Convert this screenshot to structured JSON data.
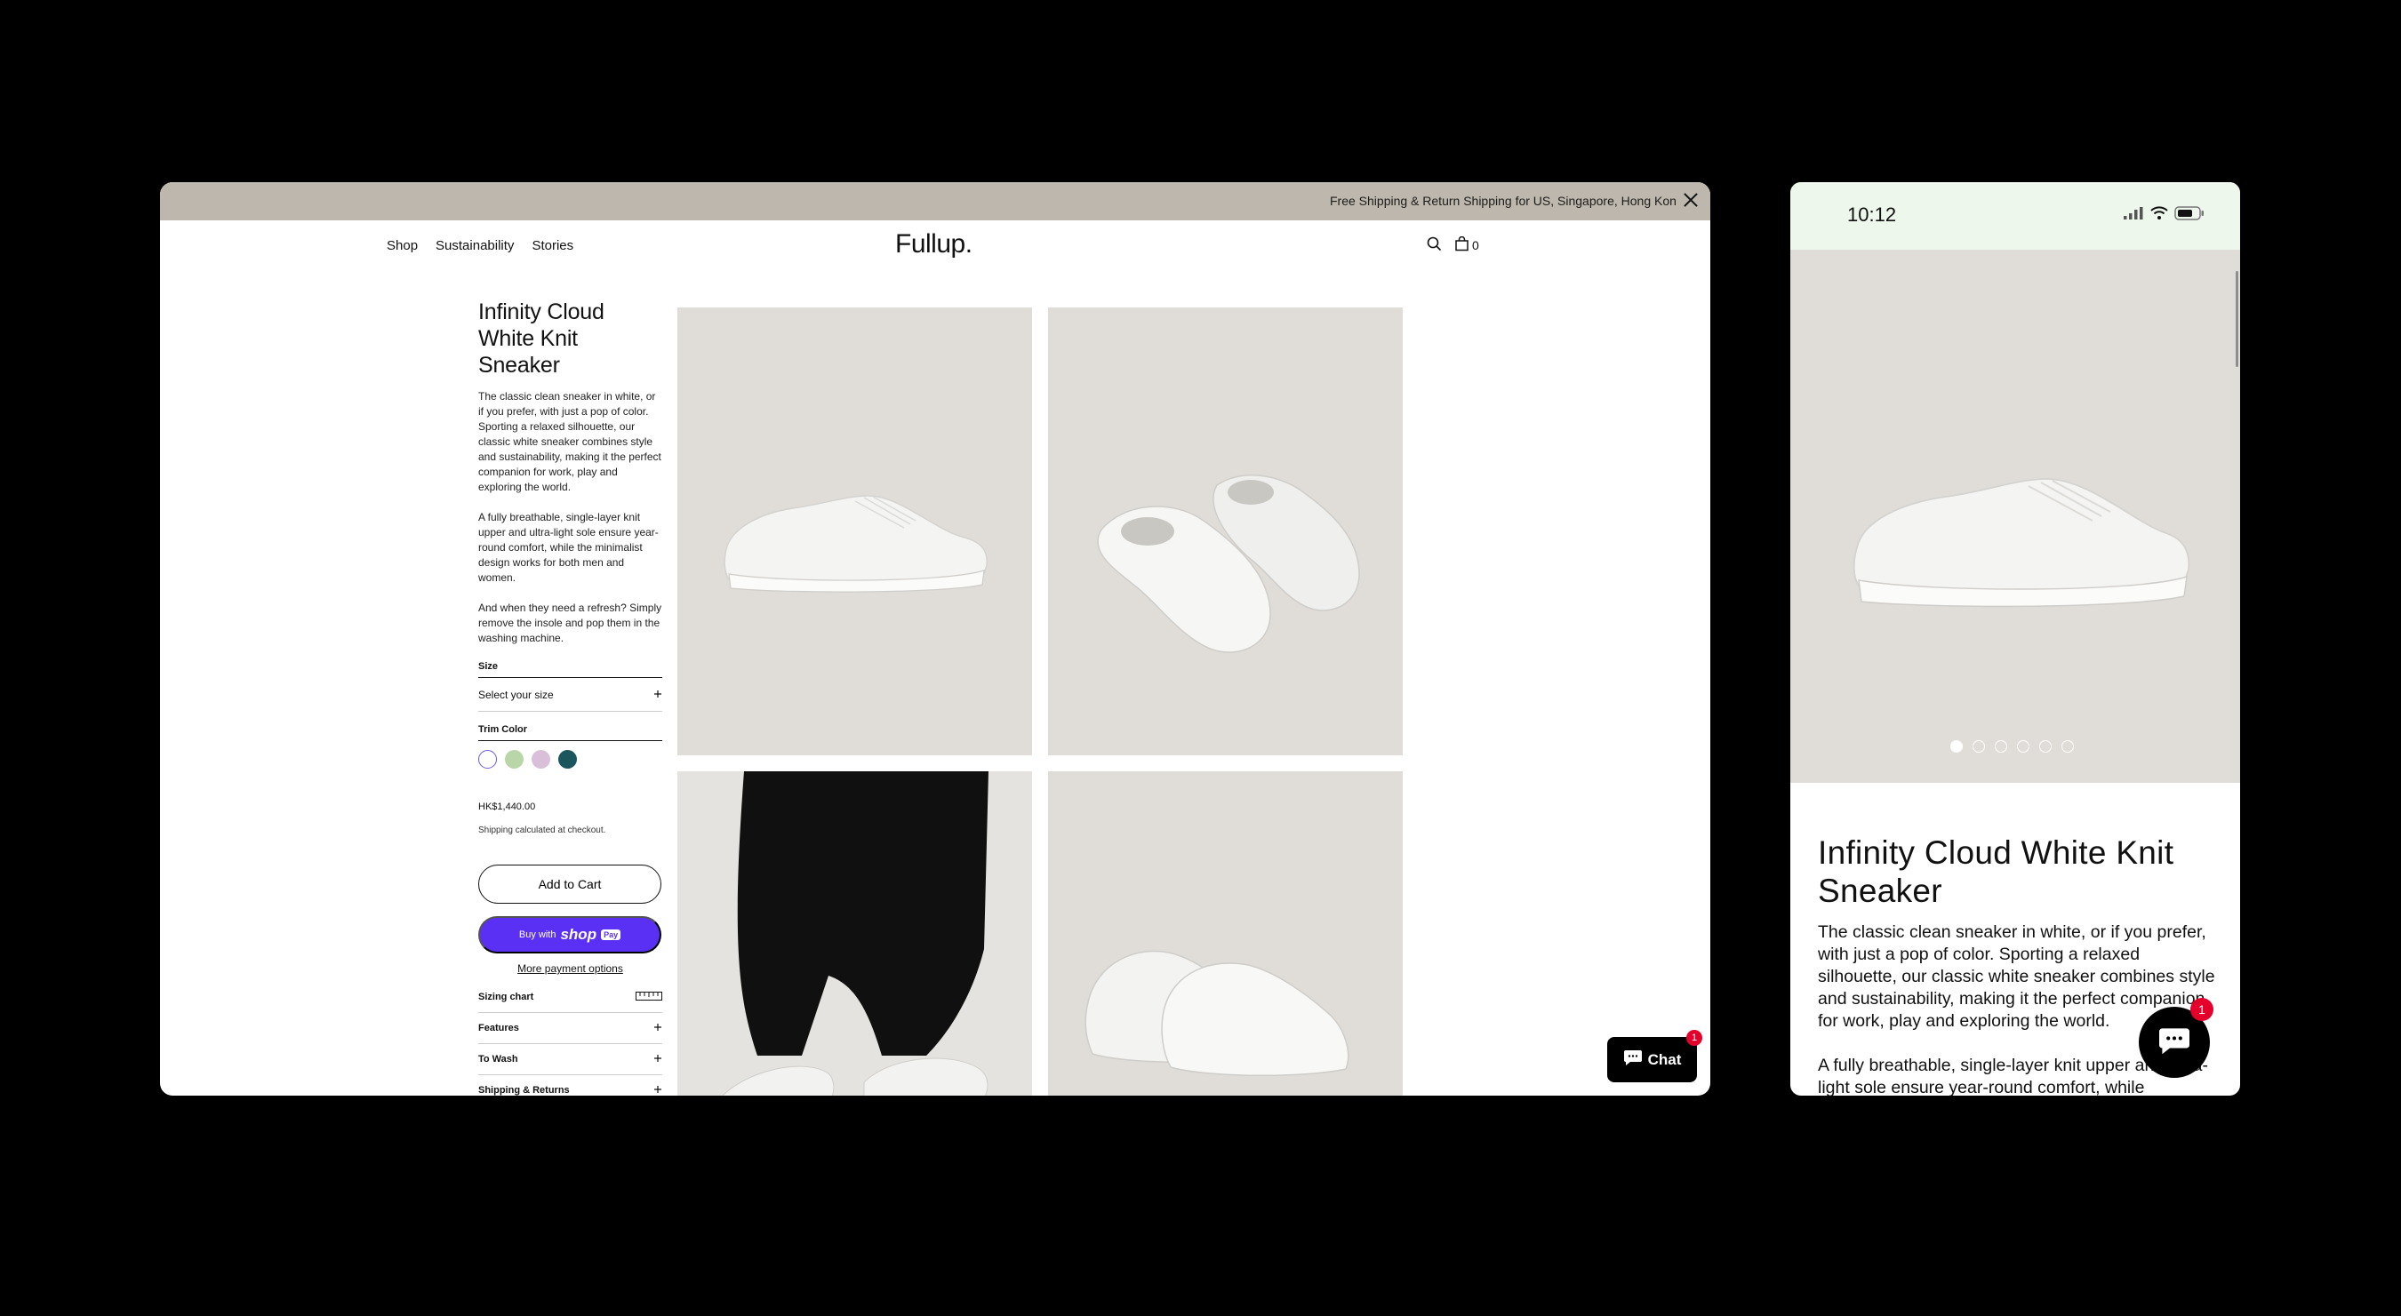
{
  "desktop": {
    "announcement": "Free Shipping & Return Shipping for US, Singapore, Hong Kong cu",
    "nav": {
      "links": [
        "Shop",
        "Sustainability",
        "Stories"
      ],
      "logo": "Fullup.",
      "cart_count": "0"
    },
    "product": {
      "title": "Infinity Cloud White Knit Sneaker",
      "description": [
        "The classic clean sneaker in white, or if you prefer, with just a pop of color. Sporting a relaxed silhouette, our classic white sneaker combines style and sustainability, making it the perfect companion for work, play and exploring the world.",
        "A fully breathable, single-layer knit upper and ultra-light sole ensure year-round comfort, while the minimalist design works for both men and women.",
        "And when they need a refresh? Simply remove the insole and pop them in the washing machine."
      ],
      "size_label": "Size",
      "size_placeholder": "Select your size",
      "trim_label": "Trim Color",
      "trim_colors": [
        "#ffffff",
        "#b9d6a8",
        "#d9bfd8",
        "#1b555d"
      ],
      "price": "HK$1,440.00",
      "shipping_note": "Shipping calculated at checkout.",
      "add_to_cart": "Add to Cart",
      "buy_with": "Buy with",
      "shop_word": "shop",
      "pay_word": "Pay",
      "more_payment": "More payment options",
      "accordion": [
        "Sizing chart",
        "Features",
        "To Wash",
        "Shipping & Returns"
      ]
    },
    "chat_label": "Chat",
    "chat_badge": "1"
  },
  "mobile": {
    "time": "10:12",
    "title": "Infinity Cloud White Knit Sneaker",
    "description": [
      "The classic clean sneaker in white, or if you prefer, with just a pop of color. Sporting a relaxed silhouette, our classic white sneaker combines style and sustainability, making it the perfect companion for work, play and exploring the world.",
      "A fully breathable, single-layer knit upper and ultra-light sole ensure year-round comfort, while"
    ],
    "carousel_dots": 6,
    "carousel_active": 1,
    "chat_badge": "1"
  }
}
